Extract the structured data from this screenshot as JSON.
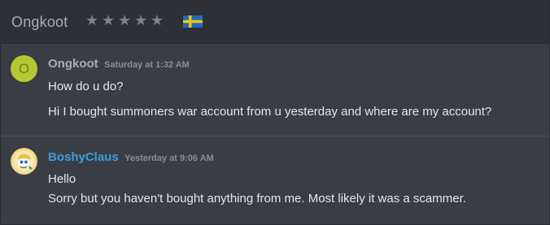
{
  "header": {
    "title": "Ongkoot",
    "rating_stars": 0,
    "rating_max": 5,
    "flag_icon": "sweden-flag-icon"
  },
  "messages": [
    {
      "username": "Ongkoot",
      "timestamp": "Saturday at 1:32 AM",
      "avatar_letter": "O",
      "lines": [
        "How do u do?",
        "Hi I bought summoners war account from u yesterday and where are my account?"
      ]
    },
    {
      "username": "BoshyClaus",
      "timestamp": "Yesterday at 9:06 AM",
      "avatar_icon": "cartoon-avatar-icon",
      "lines": [
        "Hello",
        "Sorry but you haven't bought anything from me. Most likely it was a scammer."
      ]
    }
  ],
  "colors": {
    "background": "#3a3e44",
    "header_background": "#2d3035",
    "username_blue": "#3f9be0",
    "avatar_green": "#b5c833"
  }
}
